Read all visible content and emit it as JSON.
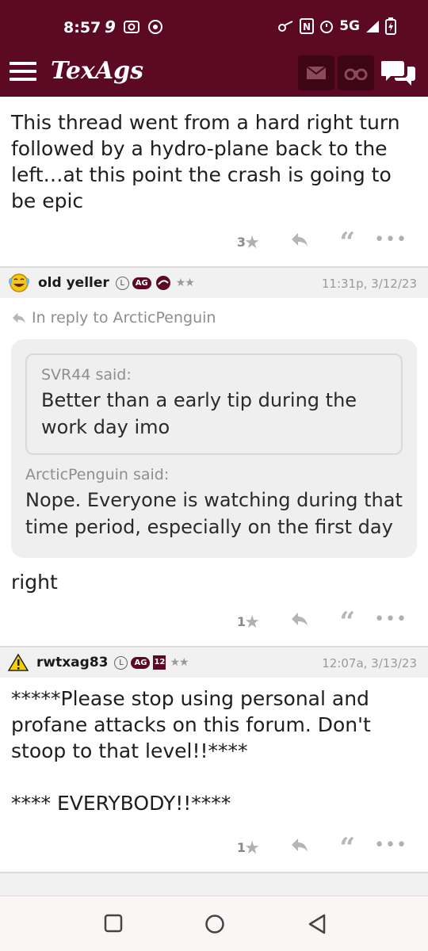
{
  "status": {
    "time": "8:57",
    "network": "5G"
  },
  "app": {
    "logo": "TexAgs"
  },
  "posts": [
    {
      "body": "This thread went from a hard right turn followed by a hydro-plane back to the left…at this point the crash is going to be epic",
      "star_count": "3"
    },
    {
      "username": "old yeller",
      "badges": {
        "l": "L",
        "ag": "AG"
      },
      "rating": "★★",
      "timestamp": "11:31p, 3/12/23",
      "in_reply_to": "In reply to ArcticPenguin",
      "quotes": [
        {
          "said": "SVR44 said:",
          "text": "Better than a early tip during the work day imo"
        },
        {
          "said": "ArcticPenguin said:",
          "text": "Nope. Everyone is watching during that time period, especially on the first day"
        }
      ],
      "body": "right",
      "star_count": "1"
    },
    {
      "username": "rwtxag83",
      "badges": {
        "l": "L",
        "ag": "AG",
        "num": "12"
      },
      "rating": "★★",
      "timestamp": "12:07a, 3/13/23",
      "body_line1": "*****Please stop using personal and profane attacks on this forum. Don't stoop to that level!!****",
      "body_line2": "**** EVERYBODY!!****",
      "star_count": "1"
    }
  ],
  "icons": {
    "menu": "hamburger-icon",
    "mail": "envelope-icon",
    "binoculars": "binoculars-icon",
    "chat": "chat-bubbles-icon",
    "reply": "reply-arrow-icon",
    "quote": "quote-icon",
    "more": "more-dots-icon",
    "star": "star-icon"
  },
  "colors": {
    "brand": "#5c0a23",
    "header_bg": "#f1f1f1",
    "quote_bg": "#efefef"
  }
}
